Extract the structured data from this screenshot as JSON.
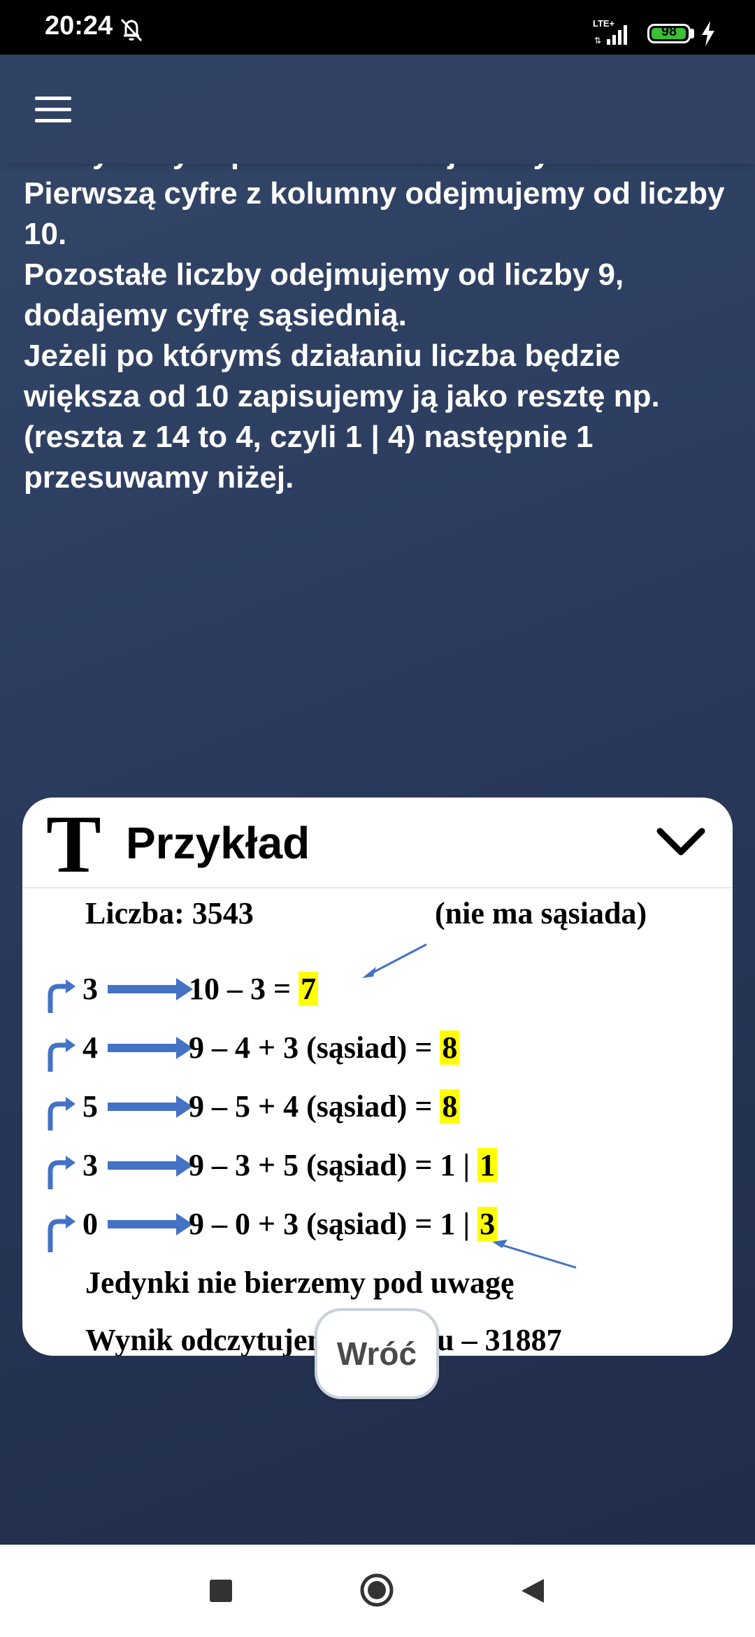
{
  "status_bar": {
    "time": "20:24",
    "network": "LTE+",
    "battery": "98",
    "battery_level": 0.98
  },
  "app_bar": {
    "menu_icon": "hamburger-menu-icon"
  },
  "instructions": {
    "line_1": "Zaczynamy zapis od ostatniej liczby.",
    "line_2": "Pierwszą cyfre z kolumny odejmujemy od liczby 10.",
    "line_3": "Pozostałe liczby odejmujemy od liczby 9, dodajemy cyfrę sąsiednią.",
    "line_4": "Jeżeli po którymś działaniu liczba będzie większa od 10 zapisujemy ją jako resztę np.(reszta z 14 to 4, czyli 1 | 4) następnie 1 przesuwamy niżej."
  },
  "example_card": {
    "header_icon_letter": "T",
    "title": "Przykład",
    "chevron_icon": "chevron-down-icon",
    "number_line": "Liczba: 3543",
    "note": "(nie ma sąsiada)",
    "rows": [
      {
        "digit": "3",
        "expr": "10 – 3 = ",
        "result": "7"
      },
      {
        "digit": "4",
        "expr": "9 – 4 + 3 (sąsiad) = ",
        "result": "8"
      },
      {
        "digit": "5",
        "expr": "9 – 5 + 4 (sąsiad) = ",
        "result": "8"
      },
      {
        "digit": "3",
        "expr": "9 – 3 + 5 (sąsiad) = 1 | ",
        "result": "1"
      },
      {
        "digit": "0",
        "expr": "9 – 0 + 3 (sąsiad) = 1 | ",
        "result": "3"
      }
    ],
    "footer_1": "Jedynki nie bierzemy pod uwagę",
    "footer_2": "Wynik odczytujemy od dołu – 31887",
    "highlight_color": "#ffff00",
    "arrow_color": "#4472c4"
  },
  "back_button": {
    "label": "Wróć"
  },
  "nav_bar": {
    "recents_icon": "recents-square-icon",
    "home_icon": "home-circle-icon",
    "back_icon": "back-triangle-icon"
  }
}
